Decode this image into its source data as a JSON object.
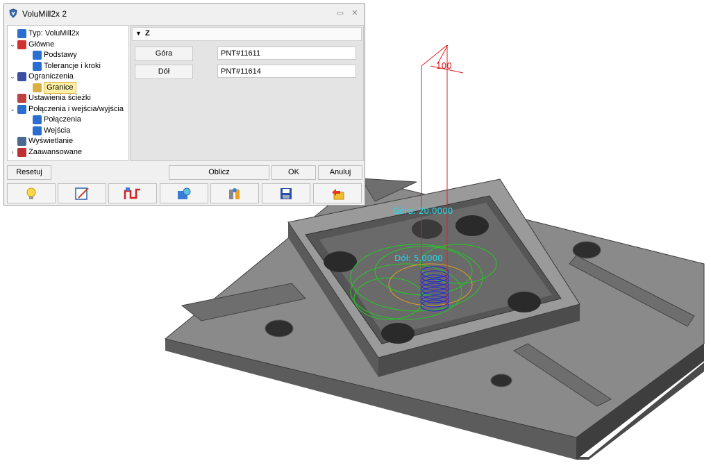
{
  "window": {
    "title": "VoluMill2x 2",
    "app_icon": "volumill-shield-icon",
    "buttons": [
      "restore-icon",
      "close-icon"
    ]
  },
  "tree": {
    "items": [
      {
        "label": "Typ: VoluMill2x",
        "icon": "toolpath-type-icon",
        "level": 0,
        "expander": "none"
      },
      {
        "label": "Główne",
        "icon": "main-settings-icon",
        "level": 0,
        "expander": "expanded"
      },
      {
        "label": "Podstawy",
        "icon": "basics-icon",
        "level": 1,
        "expander": "none"
      },
      {
        "label": "Tolerancje i kroki",
        "icon": "tolerance-icon",
        "level": 1,
        "expander": "none"
      },
      {
        "label": "Ograniczenia",
        "icon": "limits-icon",
        "level": 0,
        "expander": "expanded"
      },
      {
        "label": "Granice",
        "icon": "boundary-icon",
        "level": 1,
        "expander": "none",
        "selected": true
      },
      {
        "label": "Ustawienia ścieżki",
        "icon": "path-settings-icon",
        "level": 0,
        "expander": "none"
      },
      {
        "label": "Połączenia i wejścia/wyjścia",
        "icon": "links-icon",
        "level": 0,
        "expander": "expanded"
      },
      {
        "label": "Połączenia",
        "icon": "connection-icon",
        "level": 1,
        "expander": "none"
      },
      {
        "label": "Wejścia",
        "icon": "entry-icon",
        "level": 1,
        "expander": "none"
      },
      {
        "label": "Wyświetlanie",
        "icon": "display-icon",
        "level": 0,
        "expander": "none"
      },
      {
        "label": "Zaawansowane",
        "icon": "advanced-icon",
        "level": 0,
        "expander": "collapsed"
      }
    ]
  },
  "properties": {
    "section_title": "Z",
    "rows": [
      {
        "name": "Góra",
        "value": "PNT#11611"
      },
      {
        "name": "Dół",
        "value": "PNT#11614"
      }
    ]
  },
  "buttons": {
    "reset": "Resetuj",
    "compute": "Oblicz",
    "ok": "OK",
    "cancel": "Anuluj"
  },
  "toolbar": [
    "lightbulb-icon",
    "edit-icon",
    "toolpath-icon",
    "settings-icon",
    "parameters-icon",
    "save-icon",
    "undo-icon"
  ],
  "viewport": {
    "top_label": "Góra: 20.0000",
    "bottom_label": "Dół: 5.0000",
    "dimension_label": "100",
    "colors": {
      "part": "#6a6a6a",
      "toolpath_green": "#22cc22",
      "toolpath_blue": "#1020d0",
      "annotation_red": "#e02020",
      "label_cyan": "#22d8e8"
    }
  }
}
